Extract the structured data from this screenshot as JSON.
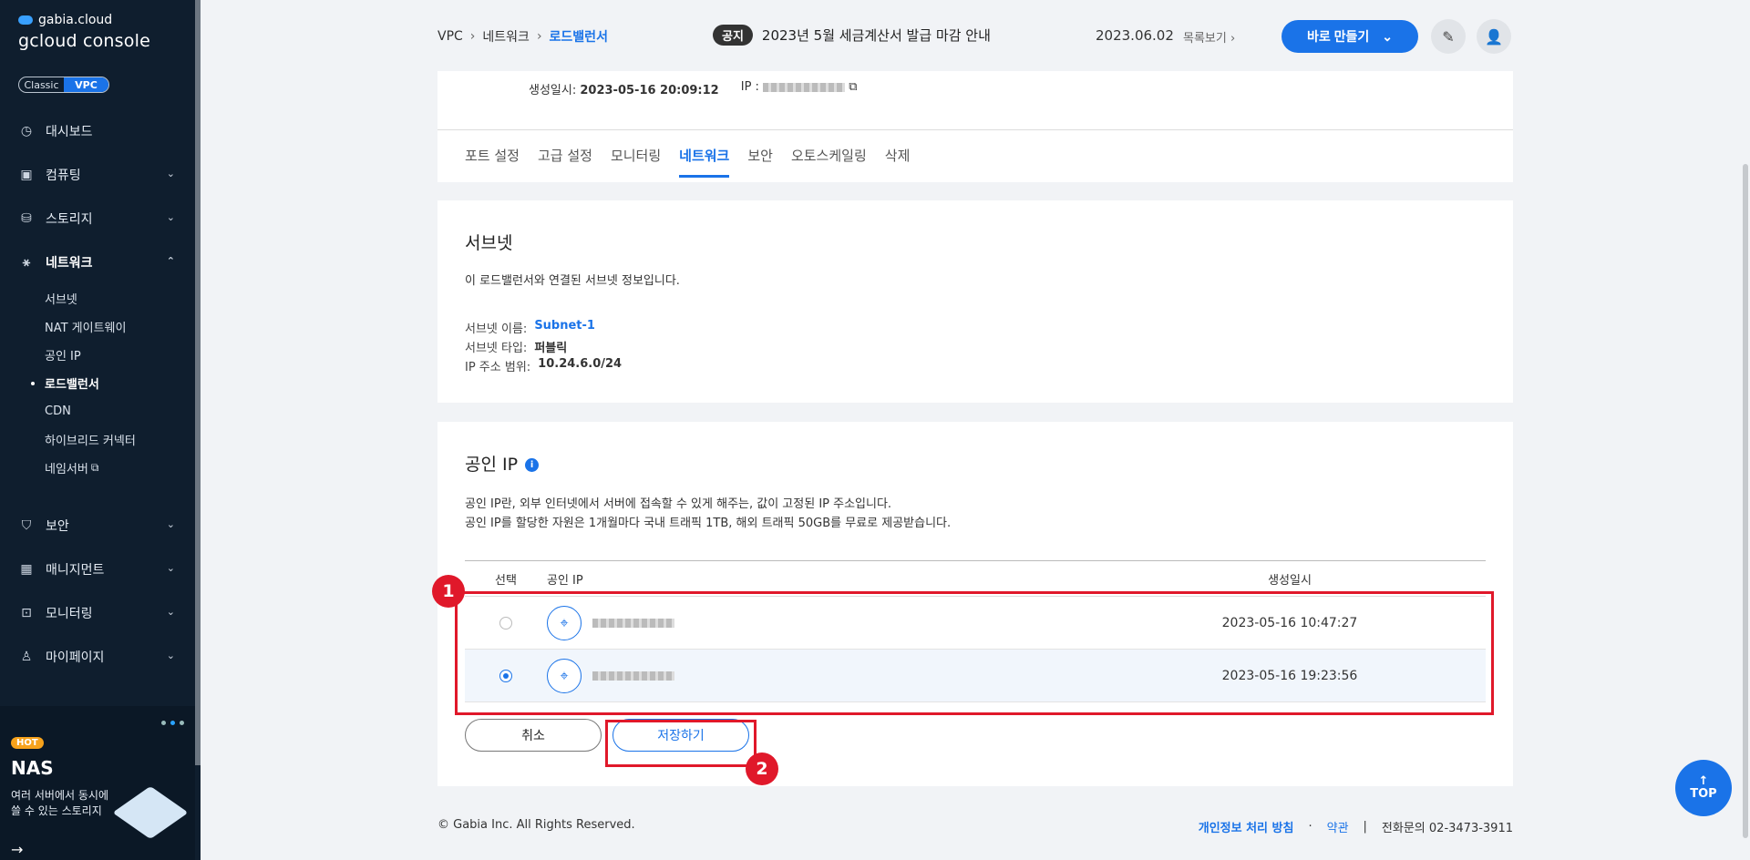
{
  "sidebar": {
    "brand_top": "gabia.cloud",
    "brand_bottom": "gcloud console",
    "toggle": [
      "Classic",
      "VPC"
    ],
    "menu": [
      {
        "label": "대시보드",
        "icon": "dashboard-icon"
      },
      {
        "label": "컴퓨팅",
        "icon": "cpu-icon"
      },
      {
        "label": "스토리지",
        "icon": "storage-icon"
      },
      {
        "label": "네트워크",
        "icon": "network-icon"
      }
    ],
    "network_sub": [
      "서브넷",
      "NAT 게이트웨이",
      "공인 IP",
      "로드밸런서",
      "CDN",
      "하이브리드 커넥터",
      "네임서버"
    ],
    "menu_lower": [
      {
        "label": "보안",
        "icon": "shield-icon"
      },
      {
        "label": "매니지먼트",
        "icon": "management-icon"
      },
      {
        "label": "모니터링",
        "icon": "monitor-icon"
      },
      {
        "label": "마이페이지",
        "icon": "user-icon"
      }
    ],
    "promo": {
      "badge": "HOT",
      "title": "NAS",
      "desc": "여러 서버에서 동시에 쓸 수 있는 스토리지"
    }
  },
  "header": {
    "breadcrumb": [
      "VPC",
      "네트워크",
      "로드밸런서"
    ],
    "notice_badge": "공지",
    "notice_text": "2023년 5월 세금계산서 발급 마감 안내",
    "notice_date": "2023.06.02",
    "notice_list": "목록보기",
    "make_button": "바로 만들기"
  },
  "detail": {
    "created_label": "생성일시:",
    "created_value": "2023-05-16 20:09:12",
    "ip_label": "IP :"
  },
  "tabs": [
    "포트 설정",
    "고급 설정",
    "모니터링",
    "네트워크",
    "보안",
    "오토스케일링",
    "삭제"
  ],
  "subnet": {
    "title": "서브넷",
    "desc": "이 로드밸런서와 연결된 서브넷 정보입니다.",
    "name_label": "서브넷 이름:",
    "name_value": "Subnet-1",
    "type_label": "서브넷 타입:",
    "type_value": "퍼블릭",
    "range_label": "IP 주소 범위:",
    "range_value": "10.24.6.0/24"
  },
  "public_ip": {
    "title": "공인 IP",
    "desc1": "공인 IP란, 외부 인터넷에서 서버에 접속할 수 있게 해주는, 값이 고정된 IP 주소입니다.",
    "desc2": "공인 IP를 할당한 자원은 1개월마다 국내 트래픽 1TB, 해외 트래픽 50GB를 무료로 제공받습니다.",
    "col_select": "선택",
    "col_ip": "공인 IP",
    "col_date": "생성일시",
    "rows": [
      {
        "date": "2023-05-16 10:47:27",
        "selected": false
      },
      {
        "date": "2023-05-16 19:23:56",
        "selected": true
      }
    ],
    "cancel": "취소",
    "save": "저장하기"
  },
  "annotations": [
    "1",
    "2"
  ],
  "footer": {
    "copyright": "© Gabia Inc. All Rights Reserved.",
    "privacy": "개인정보 처리 방침",
    "terms": "약관",
    "contact_label": "전화문의",
    "contact_number": "02-3473-3911"
  },
  "top_button": "TOP"
}
